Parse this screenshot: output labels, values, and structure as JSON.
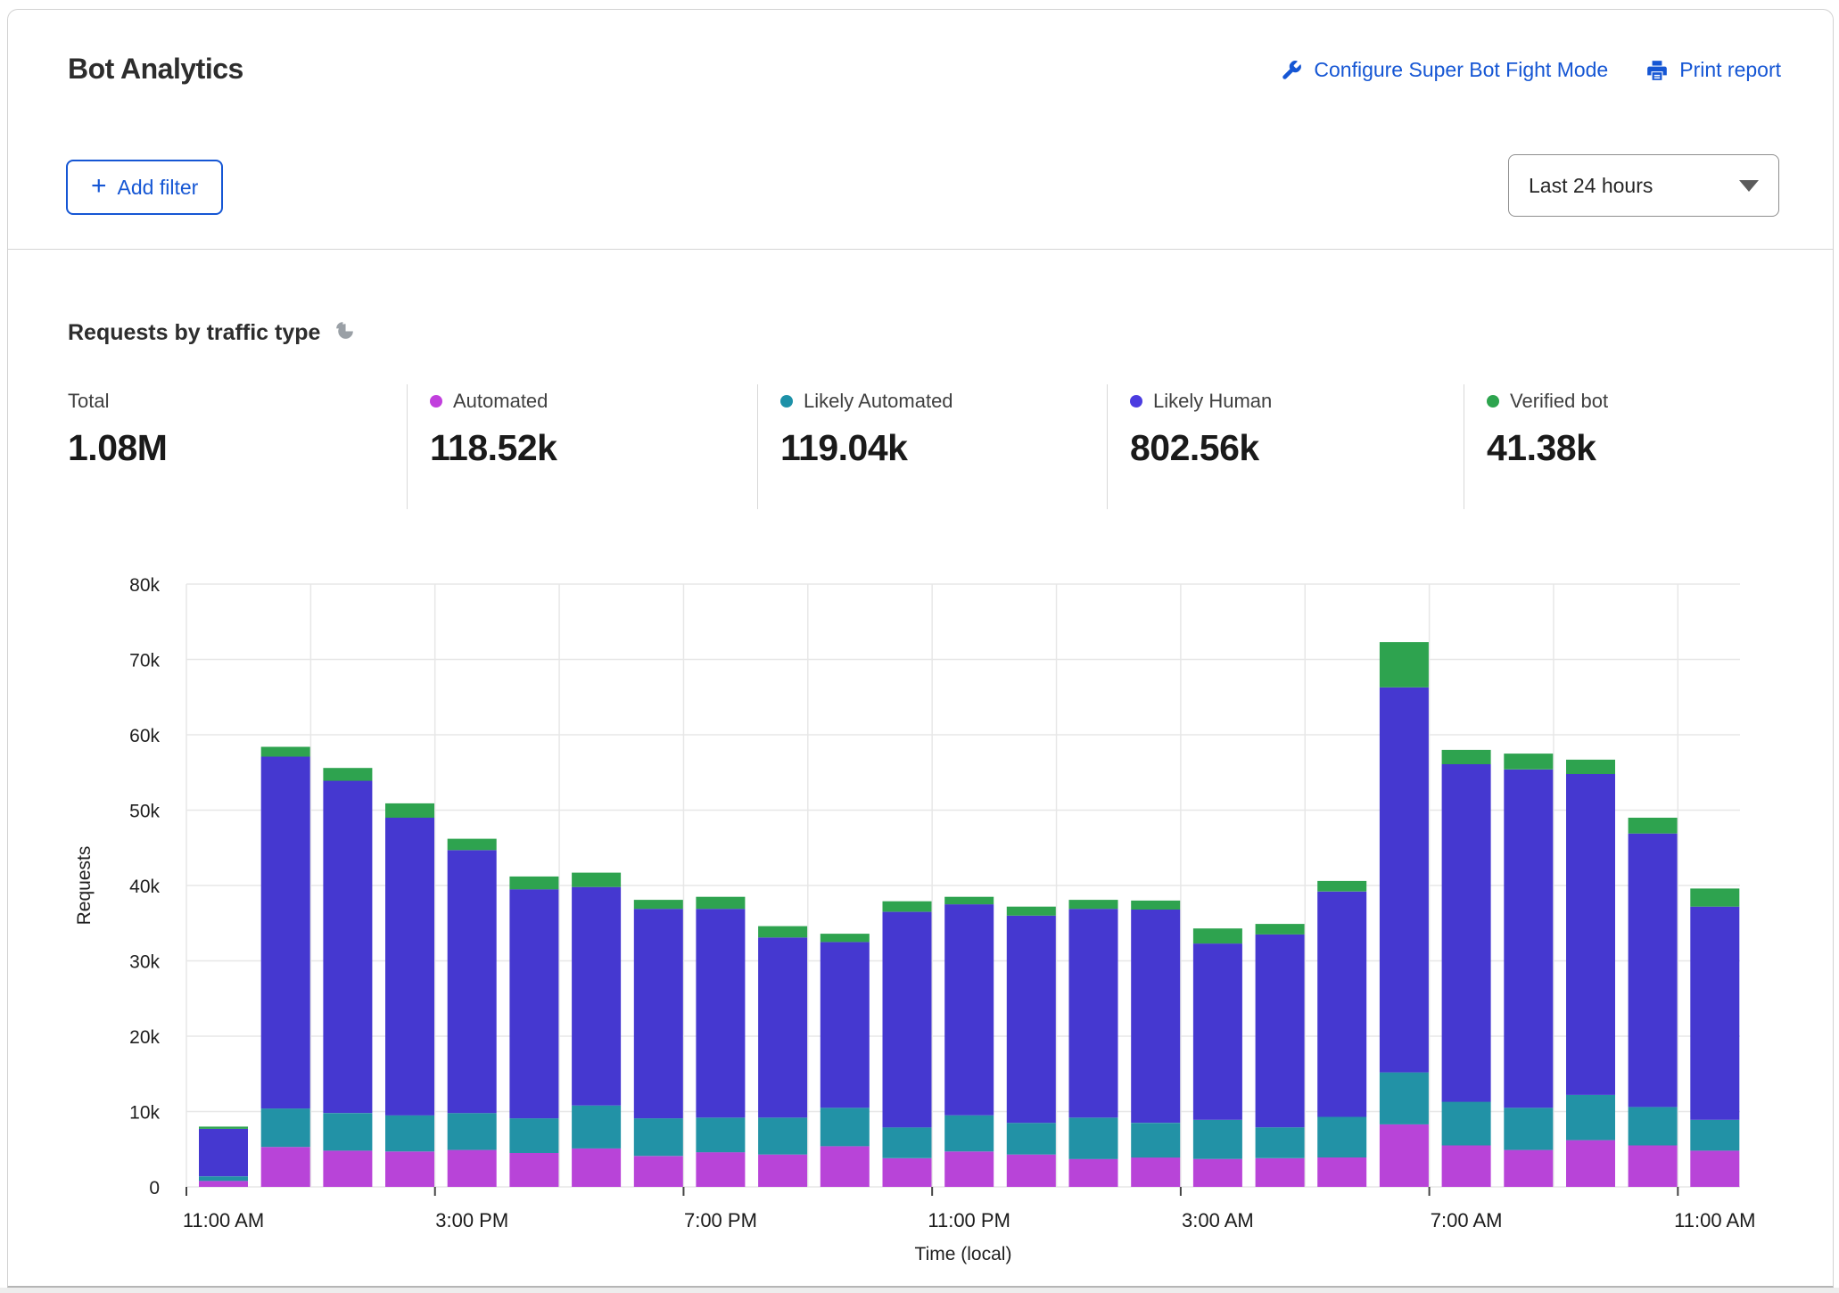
{
  "header": {
    "title": "Bot Analytics",
    "configure_link": "Configure Super Bot Fight Mode",
    "print_link": "Print report",
    "add_filter_label": "Add filter",
    "time_range_value": "Last 24 hours"
  },
  "section": {
    "heading": "Requests by traffic type"
  },
  "stats": [
    {
      "label": "Total",
      "value": "1.08M"
    },
    {
      "label": "Automated",
      "value": "118.52k",
      "color": "#c13fdd"
    },
    {
      "label": "Likely Automated",
      "value": "119.04k",
      "color": "#1d91a8"
    },
    {
      "label": "Likely Human",
      "value": "802.56k",
      "color": "#4b3ce0"
    },
    {
      "label": "Verified bot",
      "value": "41.38k",
      "color": "#2da44e"
    }
  ],
  "chart_data": {
    "type": "bar",
    "stacked": true,
    "title": "Requests by traffic type",
    "xlabel": "Time (local)",
    "ylabel": "Requests",
    "ylim": [
      0,
      80000
    ],
    "ytick_step": 10000,
    "ytick_labels": [
      "0",
      "10k",
      "20k",
      "30k",
      "40k",
      "50k",
      "60k",
      "70k",
      "80k"
    ],
    "grid": true,
    "legend_position": "top",
    "categories": [
      "11:00 AM",
      "12:00 PM",
      "1:00 PM",
      "2:00 PM",
      "3:00 PM",
      "4:00 PM",
      "5:00 PM",
      "6:00 PM",
      "7:00 PM",
      "8:00 PM",
      "9:00 PM",
      "10:00 PM",
      "11:00 PM",
      "12:00 AM",
      "1:00 AM",
      "2:00 AM",
      "3:00 AM",
      "4:00 AM",
      "5:00 AM",
      "6:00 AM",
      "7:00 AM",
      "8:00 AM",
      "9:00 AM",
      "10:00 AM",
      "11:00 AM"
    ],
    "xtick_indices": [
      0,
      4,
      8,
      12,
      16,
      20,
      24
    ],
    "xtick_labels": [
      "11:00 AM",
      "3:00 PM",
      "7:00 PM",
      "11:00 PM",
      "3:00 AM",
      "7:00 AM",
      "11:00 AM"
    ],
    "series": [
      {
        "name": "Automated",
        "color": "#b844d8",
        "values": [
          800,
          5300,
          4800,
          4700,
          4900,
          4500,
          5100,
          4100,
          4600,
          4300,
          5400,
          3800,
          4700,
          4300,
          3700,
          3900,
          3700,
          3800,
          3900,
          8300,
          5500,
          4900,
          6200,
          5500,
          4800
        ]
      },
      {
        "name": "Likely Automated",
        "color": "#2292a6",
        "values": [
          600,
          5100,
          5000,
          4800,
          4900,
          4600,
          5700,
          5000,
          4600,
          4900,
          5100,
          4100,
          4800,
          4200,
          5500,
          4600,
          5200,
          4100,
          5400,
          6900,
          5800,
          5600,
          6000,
          5100,
          4100
        ]
      },
      {
        "name": "Likely Human",
        "color": "#4538d0",
        "values": [
          6300,
          46700,
          44100,
          39500,
          34900,
          30400,
          29000,
          27800,
          27700,
          23900,
          22000,
          28600,
          28000,
          27500,
          27700,
          28300,
          23400,
          25600,
          29900,
          51100,
          44800,
          44900,
          42600,
          36300,
          28300
        ]
      },
      {
        "name": "Verified bot",
        "color": "#2ea34f",
        "values": [
          300,
          1300,
          1700,
          1900,
          1500,
          1700,
          1900,
          1200,
          1600,
          1500,
          1100,
          1400,
          1000,
          1200,
          1200,
          1200,
          2000,
          1400,
          1400,
          6000,
          1900,
          2100,
          1900,
          2100,
          2400
        ]
      }
    ]
  }
}
